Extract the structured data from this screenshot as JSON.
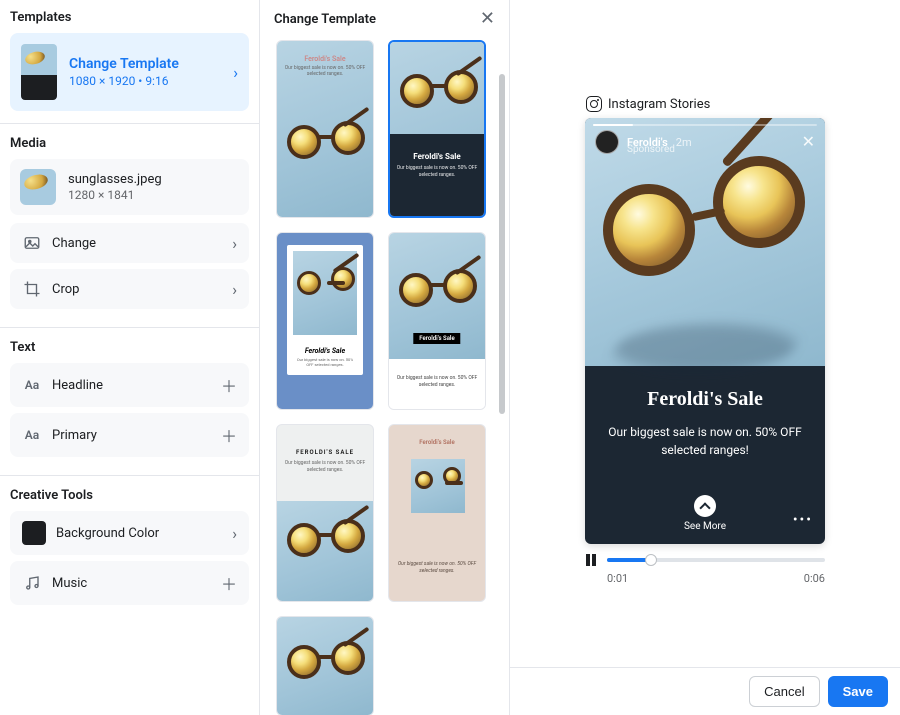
{
  "sidebar": {
    "templates": {
      "title": "Templates",
      "card": {
        "title": "Change Template",
        "subtitle": "1080 × 1920 • 9:16"
      }
    },
    "media": {
      "title": "Media",
      "file": {
        "name": "sunglasses.jpeg",
        "dimensions": "1280 × 1841"
      },
      "change": "Change",
      "crop": "Crop"
    },
    "text": {
      "title": "Text",
      "headline": "Headline",
      "primary": "Primary"
    },
    "creative": {
      "title": "Creative Tools",
      "bgcolor": "Background Color",
      "music": "Music"
    }
  },
  "templatesPanel": {
    "title": "Change Template",
    "tpl0_head": "Feroldi's Sale",
    "tpl0_sub": "Our biggest sale is now on. 50% OFF selected ranges.",
    "tpl1_head": "Feroldi's Sale",
    "tpl1_sub": "Our biggest sale is now on. 50% OFF selected ranges.",
    "tpl2_head": "Feroldi's Sale",
    "tpl2_sub": "Our biggest sale is now on. 50% OFF selected ranges.",
    "tpl3_badge": "Feroldi's Sale",
    "tpl3_sub": "Our biggest sale is now on. 50% OFF selected ranges.",
    "tpl4_head": "FEROLDI'S SALE",
    "tpl4_sub": "Our biggest sale is now on. 50% OFF selected ranges.",
    "tpl5_head": "Feroldi's Sale",
    "tpl5_sub": "Our biggest sale is now on. 50% OFF selected ranges."
  },
  "preview": {
    "placement": "Instagram Stories",
    "brand": "Feroldi's",
    "age": "2m",
    "sponsored": "Sponsored",
    "headline": "Feroldi's Sale",
    "body": "Our biggest sale is now on. 50% OFF selected ranges!",
    "cta": "See More",
    "t_cur": "0:01",
    "t_end": "0:06"
  },
  "footer": {
    "cancel": "Cancel",
    "save": "Save"
  }
}
